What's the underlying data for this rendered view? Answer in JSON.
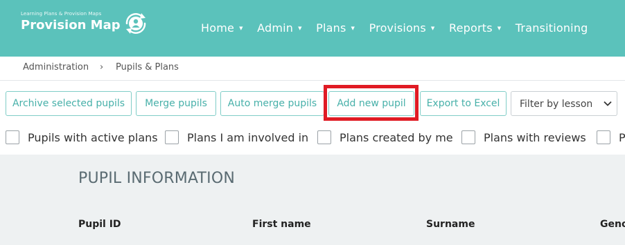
{
  "brand": {
    "tagline": "Learning Plans & Provision Maps",
    "name": "Provision Map",
    "icon": "person-refresh-icon"
  },
  "nav": {
    "items": [
      {
        "label": "Home",
        "caret": "▼"
      },
      {
        "label": "Admin",
        "caret": "▼"
      },
      {
        "label": "Plans",
        "caret": "▼"
      },
      {
        "label": "Provisions",
        "caret": "▼"
      },
      {
        "label": "Reports",
        "caret": "▼"
      },
      {
        "label": "Transitioning",
        "caret": ""
      }
    ]
  },
  "breadcrumb": {
    "items": [
      "Administration",
      "Pupils & Plans"
    ],
    "separator": "›"
  },
  "toolbar": {
    "archive": "Archive selected pupils",
    "merge": "Merge pupils",
    "auto_merge": "Auto merge pupils",
    "add_new": "Add new pupil",
    "export": "Export to Excel",
    "filter_select": "Filter by lesson"
  },
  "filters": {
    "items": [
      {
        "label": "Pupils with active plans",
        "checked": false
      },
      {
        "label": "Plans I am involved in",
        "checked": false
      },
      {
        "label": "Plans created by me",
        "checked": false
      },
      {
        "label": "Plans with reviews",
        "checked": false
      },
      {
        "label": "Pl",
        "checked": false
      }
    ]
  },
  "main": {
    "section_title": "PUPIL INFORMATION",
    "columns": [
      "Pupil ID",
      "First name",
      "Surname",
      "Geno"
    ]
  },
  "colors": {
    "header": "#5bc2bb",
    "accent": "#47b0a9",
    "highlight": "#e01b24",
    "panel": "#eef1f2"
  }
}
